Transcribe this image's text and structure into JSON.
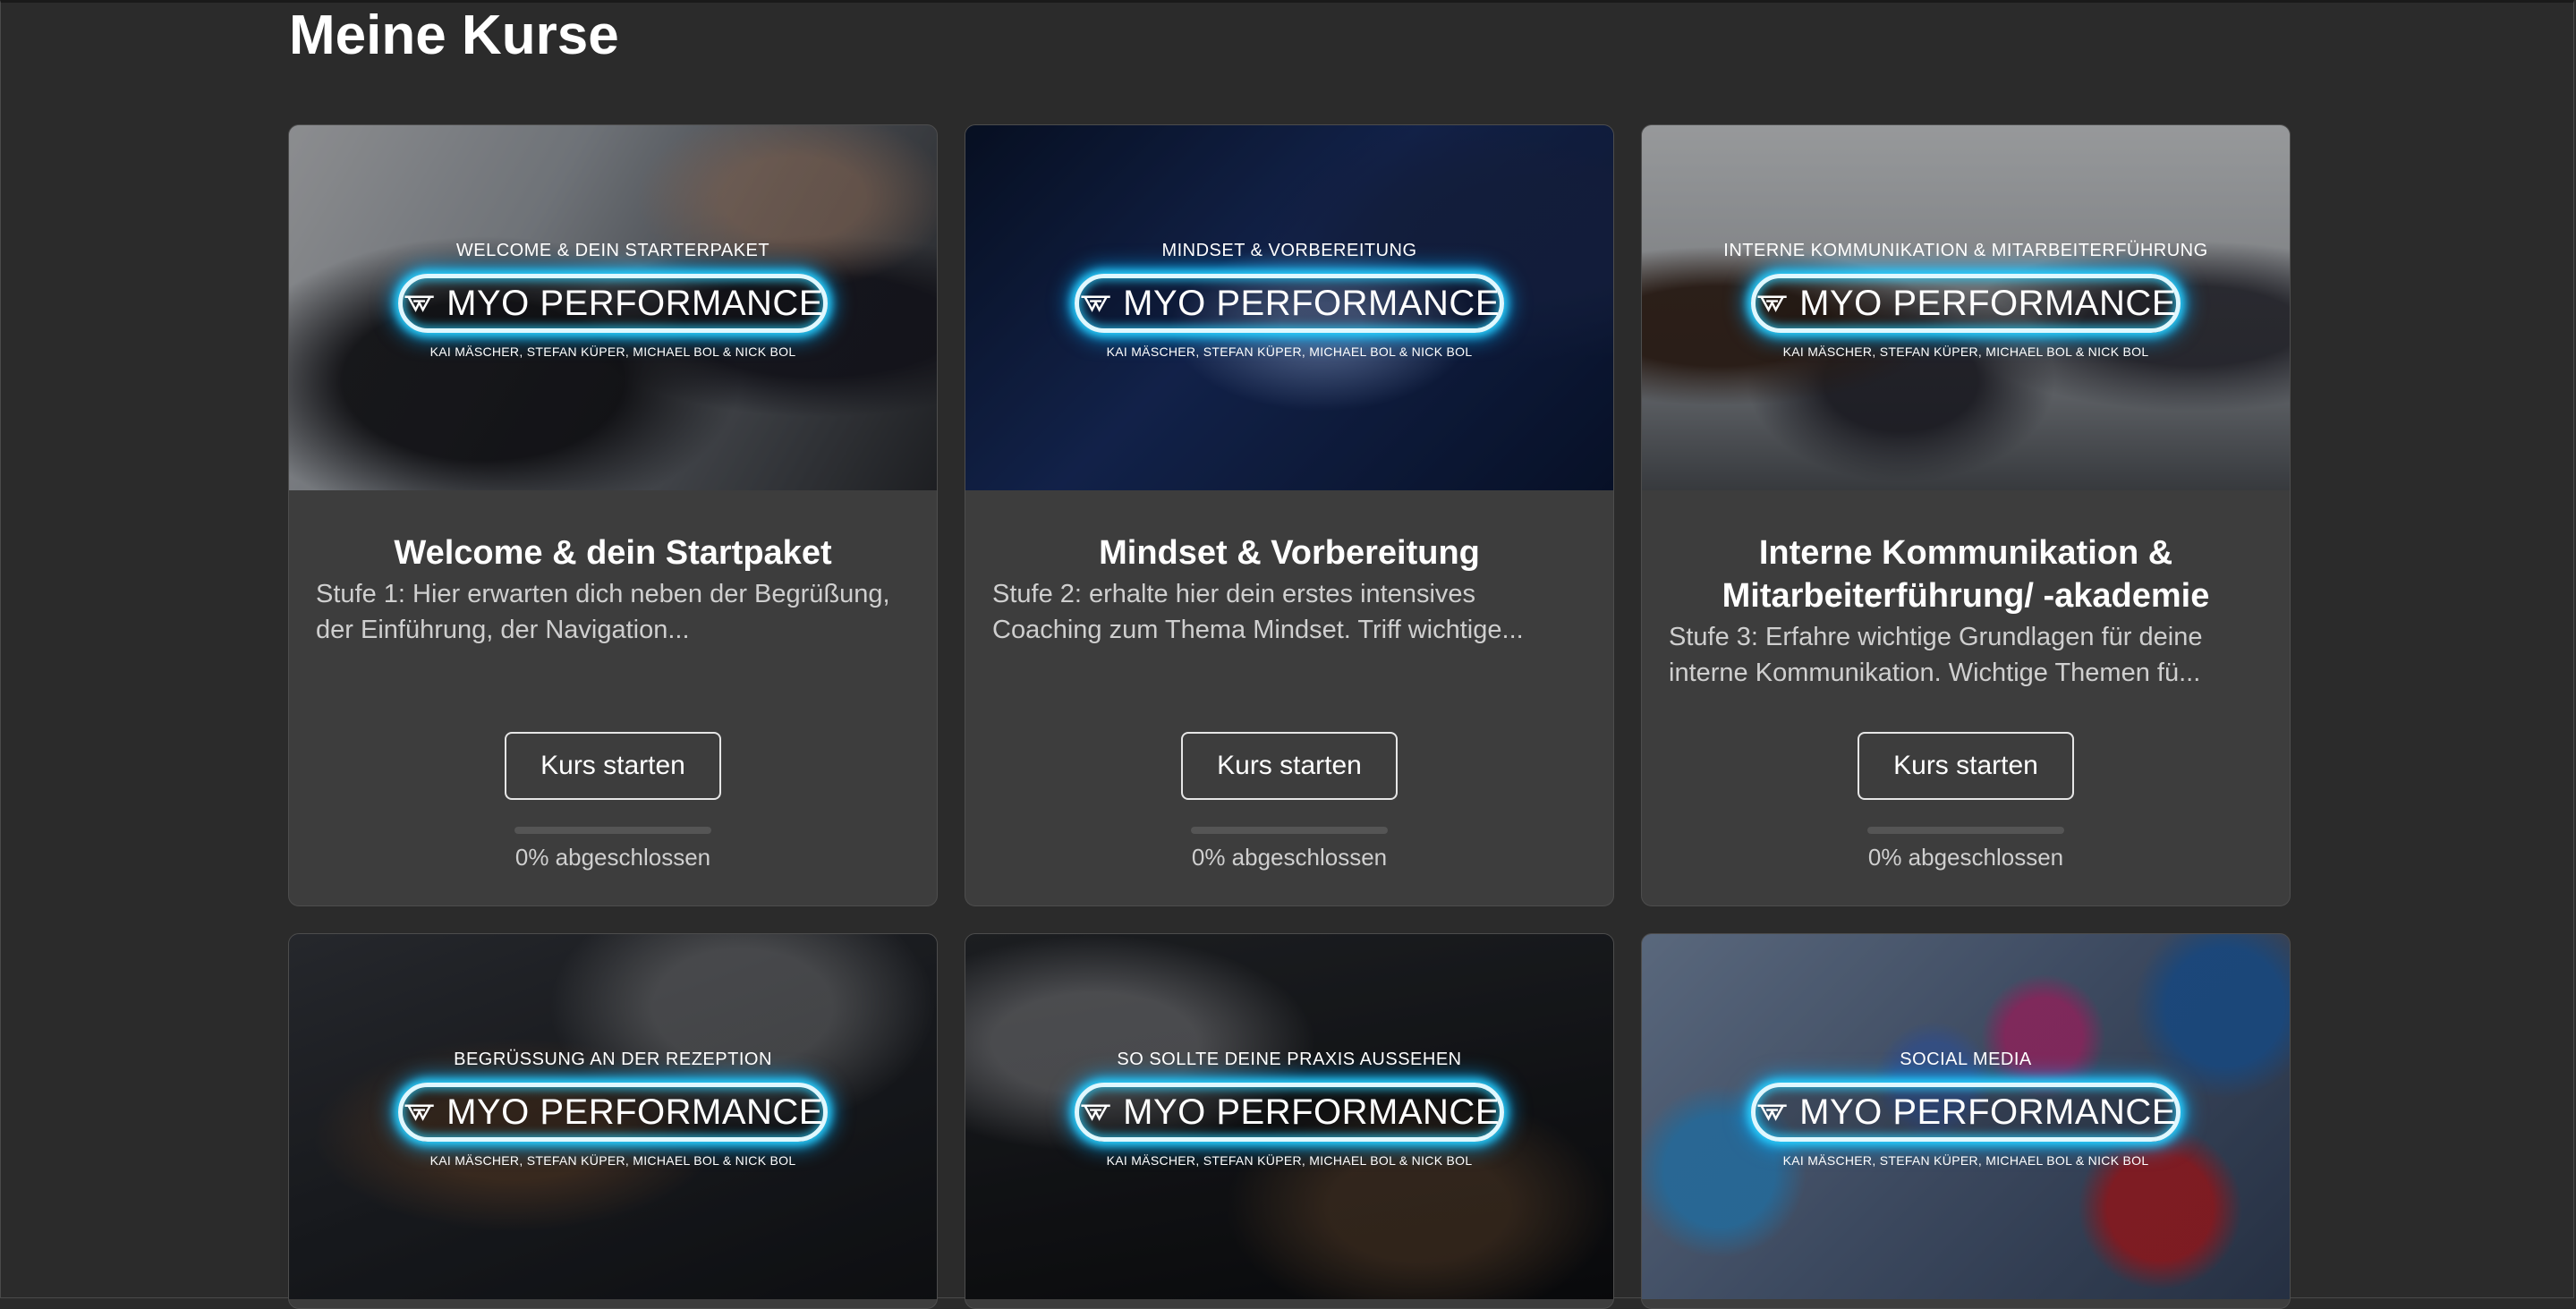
{
  "page": {
    "title": "Meine Kurse"
  },
  "brand": {
    "logo_text": "MYO PERFORMANCE",
    "authors": "KAI MÄSCHER, STEFAN KÜPER, MICHAEL BOL & NICK BOL",
    "glow_color": "#2bd2ff"
  },
  "courses": [
    {
      "kicker": "WELCOME & DEIN STARTERPAKET",
      "title": "Welcome & dein Startpaket",
      "description": "Stufe 1: Hier erwarten dich neben der Begrüßung, der Einführung, der Navigation...",
      "button_label": "Kurs starten",
      "progress_percent": 0,
      "progress_label": "0% abgeschlossen"
    },
    {
      "kicker": "MINDSET & VORBEREITUNG",
      "title": "Mindset & Vorbereitung",
      "description": "Stufe 2: erhalte hier dein erstes intensives Coaching zum Thema Mindset. Triff wichtige...",
      "button_label": "Kurs starten",
      "progress_percent": 0,
      "progress_label": "0% abgeschlossen"
    },
    {
      "kicker": "INTERNE KOMMUNIKATION & MITARBEITERFÜHRUNG",
      "title": "Interne Kommunikation & Mitarbeiterführung/ -akademie",
      "description": "Stufe 3: Erfahre wichtige Grundlagen für deine interne Kommunikation. Wichtige Themen fü...",
      "button_label": "Kurs starten",
      "progress_percent": 0,
      "progress_label": "0% abgeschlossen"
    },
    {
      "kicker": "BEGRÜßUNG AN DER REZEPTION"
    },
    {
      "kicker": "SO SOLLTE DEINE PRAXIS AUSSEHEN"
    },
    {
      "kicker": "SOCIAL MEDIA"
    }
  ]
}
